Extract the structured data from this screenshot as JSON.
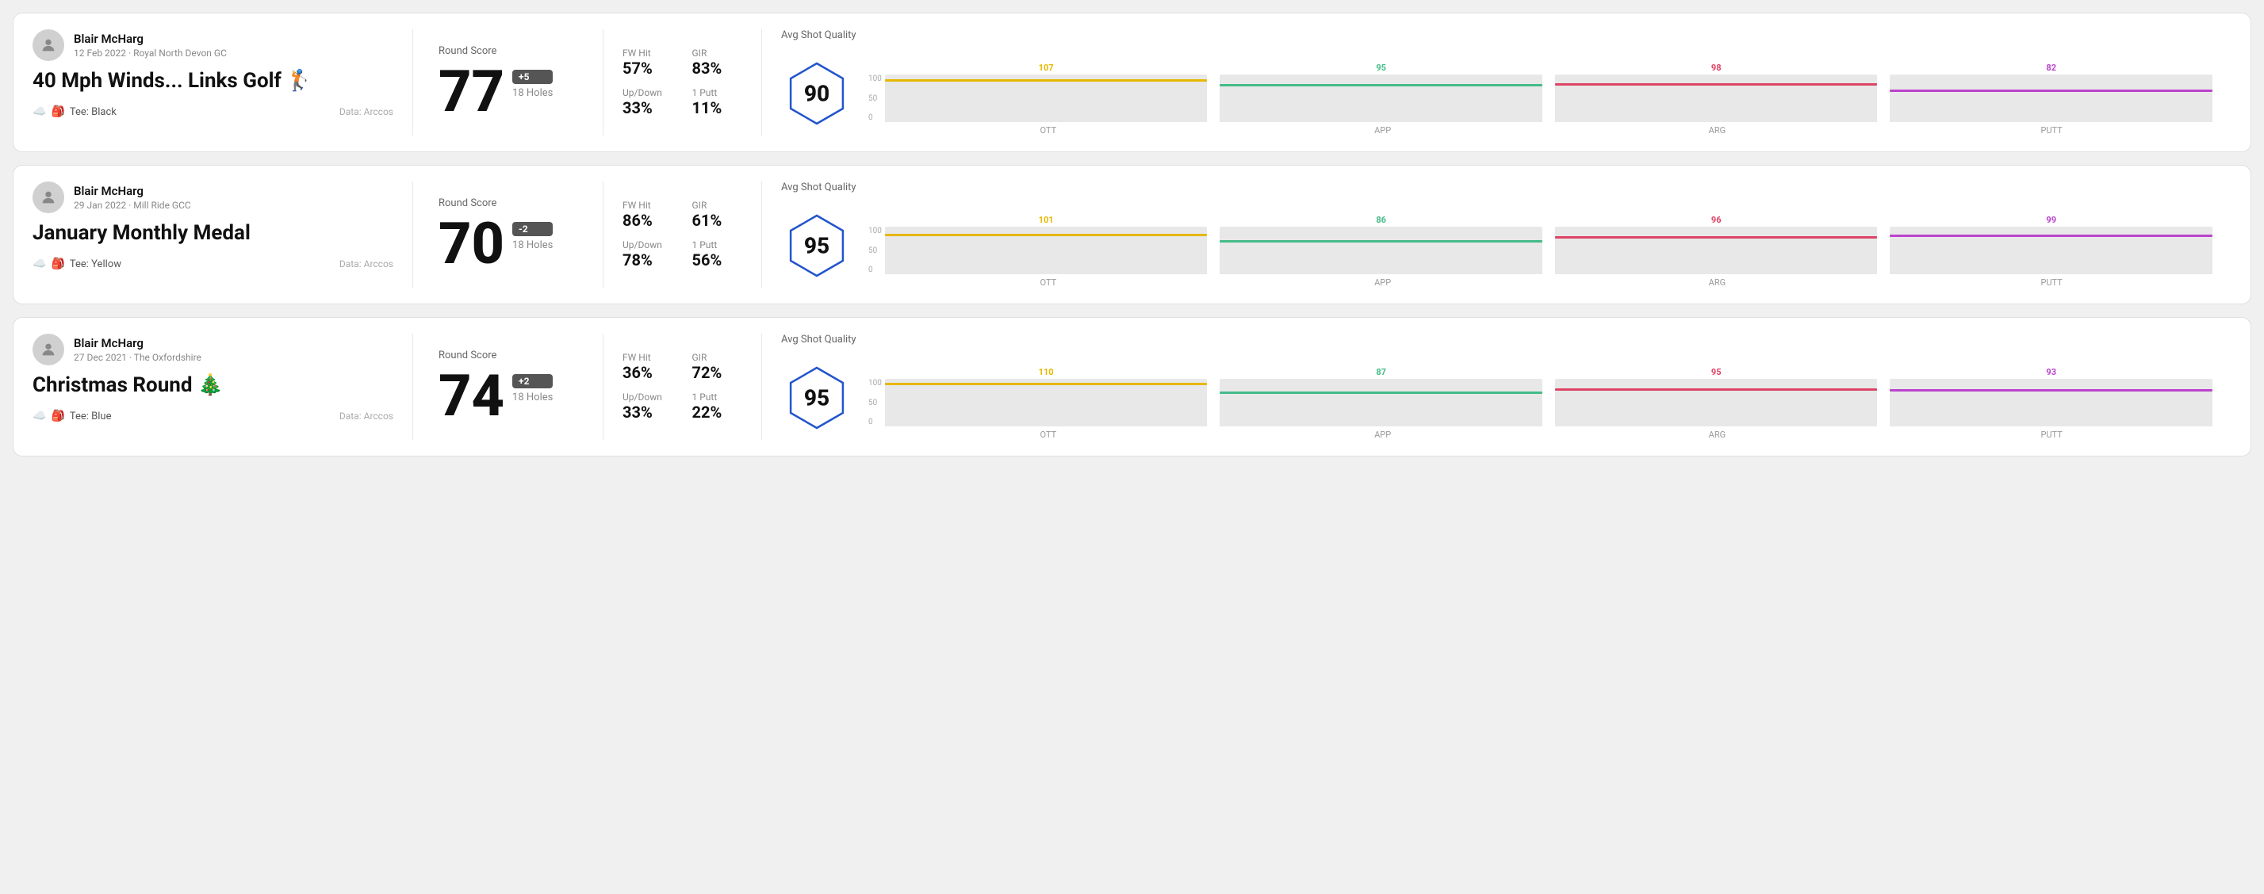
{
  "rounds": [
    {
      "id": "round1",
      "user": {
        "name": "Blair McHarg",
        "date_course": "12 Feb 2022 · Royal North Devon GC"
      },
      "title": "40 Mph Winds... Links Golf 🏌️",
      "tee": "Black",
      "data_source": "Data: Arccos",
      "score": "77",
      "score_diff": "+5",
      "score_diff_type": "positive",
      "holes": "18 Holes",
      "fw_hit": "57%",
      "gir": "83%",
      "up_down": "33%",
      "one_putt": "11%",
      "shot_quality": "90",
      "chart": {
        "bars": [
          {
            "label": "OTT",
            "value": 107,
            "color": "#e6b800"
          },
          {
            "label": "APP",
            "value": 95,
            "color": "#44bb88"
          },
          {
            "label": "ARG",
            "value": 98,
            "color": "#dd4466"
          },
          {
            "label": "PUTT",
            "value": 82,
            "color": "#bb44cc"
          }
        ]
      }
    },
    {
      "id": "round2",
      "user": {
        "name": "Blair McHarg",
        "date_course": "29 Jan 2022 · Mill Ride GCC"
      },
      "title": "January Monthly Medal",
      "tee": "Yellow",
      "data_source": "Data: Arccos",
      "score": "70",
      "score_diff": "-2",
      "score_diff_type": "negative",
      "holes": "18 Holes",
      "fw_hit": "86%",
      "gir": "61%",
      "up_down": "78%",
      "one_putt": "56%",
      "shot_quality": "95",
      "chart": {
        "bars": [
          {
            "label": "OTT",
            "value": 101,
            "color": "#e6b800"
          },
          {
            "label": "APP",
            "value": 86,
            "color": "#44bb88"
          },
          {
            "label": "ARG",
            "value": 96,
            "color": "#dd4466"
          },
          {
            "label": "PUTT",
            "value": 99,
            "color": "#bb44cc"
          }
        ]
      }
    },
    {
      "id": "round3",
      "user": {
        "name": "Blair McHarg",
        "date_course": "27 Dec 2021 · The Oxfordshire"
      },
      "title": "Christmas Round 🎄",
      "tee": "Blue",
      "data_source": "Data: Arccos",
      "score": "74",
      "score_diff": "+2",
      "score_diff_type": "positive",
      "holes": "18 Holes",
      "fw_hit": "36%",
      "gir": "72%",
      "up_down": "33%",
      "one_putt": "22%",
      "shot_quality": "95",
      "chart": {
        "bars": [
          {
            "label": "OTT",
            "value": 110,
            "color": "#e6b800"
          },
          {
            "label": "APP",
            "value": 87,
            "color": "#44bb88"
          },
          {
            "label": "ARG",
            "value": 95,
            "color": "#dd4466"
          },
          {
            "label": "PUTT",
            "value": 93,
            "color": "#bb44cc"
          }
        ]
      }
    }
  ],
  "labels": {
    "round_score": "Round Score",
    "fw_hit": "FW Hit",
    "gir": "GIR",
    "up_down": "Up/Down",
    "one_putt": "1 Putt",
    "avg_shot_quality": "Avg Shot Quality",
    "tee_prefix": "Tee:",
    "chart_y_100": "100",
    "chart_y_50": "50",
    "chart_y_0": "0"
  }
}
